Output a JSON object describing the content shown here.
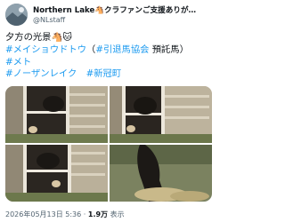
{
  "post": {
    "display_name": "Northern Lake🐴クラファンご支援ありが…",
    "handle": "@NLstaff",
    "text_line1": "夕方の光景🐴🐱",
    "tag1": "#メイショウドトウ",
    "paren_open": "（",
    "tag2": "#引退馬協会",
    "paren_rest": " 預託馬）",
    "tag3": "#メト",
    "tag4": "#ノーザンレイク",
    "tag5": "#新冠町",
    "timestamp": "2026年05月13日 5:36",
    "dot": " · ",
    "views_count": "1.9万",
    "views_label": " 表示"
  },
  "media": {
    "photos": [
      {
        "alt": "stable door with horse and cat"
      },
      {
        "alt": "stable door with horse and cat"
      },
      {
        "alt": "stable door with horse and cat"
      },
      {
        "alt": "horse eating hay"
      }
    ]
  }
}
